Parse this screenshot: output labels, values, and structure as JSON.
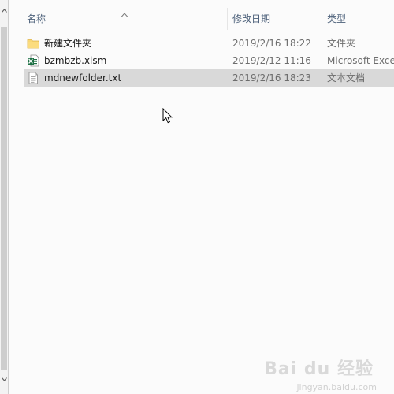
{
  "columns": {
    "name": "名称",
    "date": "修改日期",
    "type": "类型"
  },
  "files": [
    {
      "name": "新建文件夹",
      "date": "2019/2/16 18:22",
      "type": "文件夹",
      "icon": "folder-icon"
    },
    {
      "name": "bzmbzb.xlsm",
      "date": "2019/2/12 11:16",
      "type": "Microsoft Excel",
      "icon": "excel-file-icon"
    },
    {
      "name": "mdnewfolder.txt",
      "date": "2019/2/16 18:23",
      "type": "文本文档",
      "icon": "text-file-icon"
    }
  ],
  "selected_index": 2,
  "watermark": {
    "text": "Bai du 经验",
    "sub": "jingyan.baidu.com"
  },
  "colors": {
    "header_text": "#4c607a",
    "selected_row": "#d9d9d9",
    "folder": "#f5c342",
    "excel": "#1e7145"
  }
}
